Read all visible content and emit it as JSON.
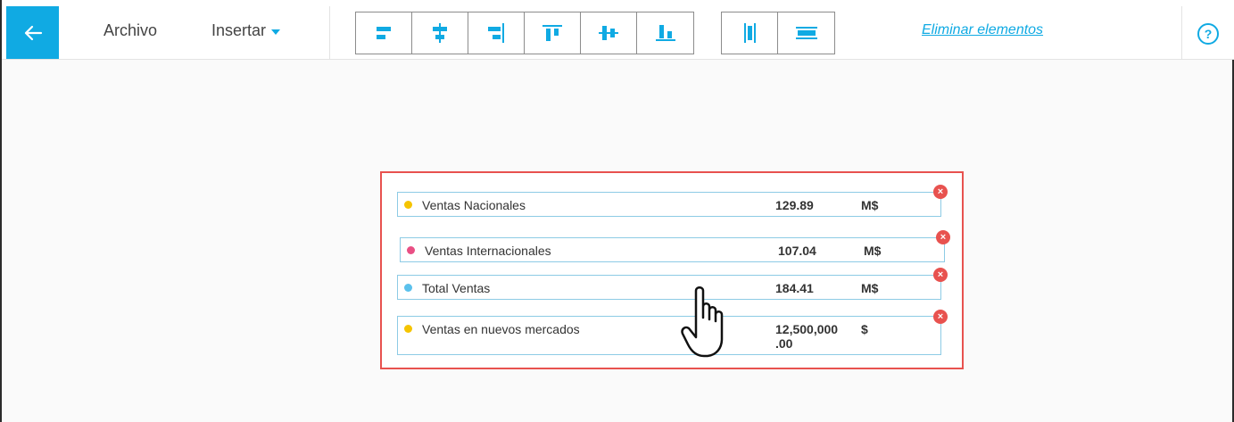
{
  "toolbar": {
    "archivo_label": "Archivo",
    "insertar_label": "Insertar",
    "delete_label": "Eliminar elementos",
    "help_label": "?",
    "align_tools": [
      "align-left-icon",
      "align-center-horizontal-icon",
      "align-right-icon",
      "align-top-icon",
      "align-middle-vertical-icon",
      "align-bottom-icon"
    ],
    "distribute_tools": [
      "distribute-horizontal-icon",
      "distribute-vertical-icon"
    ]
  },
  "colors": {
    "accent": "#10aae3",
    "selection": "#e8524f",
    "dot_yellow": "#f5c400",
    "dot_pink": "#e94f84",
    "dot_blue": "#5bc1ec"
  },
  "kpis": [
    {
      "label": "Ventas Nacionales",
      "value": "129.89",
      "unit": "M$",
      "dot": "#f5c400"
    },
    {
      "label": "Ventas Internacionales",
      "value": "107.04",
      "unit": "M$",
      "dot": "#e94f84"
    },
    {
      "label": "Total Ventas",
      "value": "184.41",
      "unit": "M$",
      "dot": "#5bc1ec"
    },
    {
      "label": "Ventas en nuevos mercados",
      "value_line1": "12,500,000",
      "value_line2": ".00",
      "unit": "$",
      "dot": "#f5c400"
    }
  ],
  "close_glyph": "×"
}
